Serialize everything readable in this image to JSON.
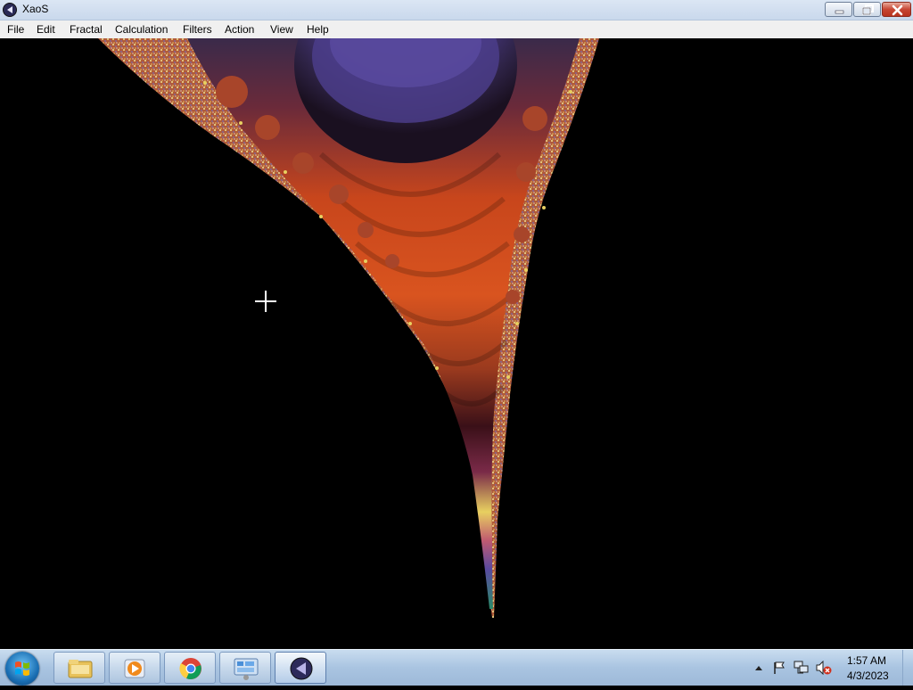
{
  "window": {
    "title": "XaoS",
    "icon": "xaos-icon",
    "controls": [
      "minimize-icon",
      "restore-icon",
      "close-icon"
    ]
  },
  "menu": {
    "items": [
      {
        "label": "File"
      },
      {
        "label": "Edit"
      },
      {
        "label": "Fractal"
      },
      {
        "label": "Calculation"
      },
      {
        "label": "Filters"
      },
      {
        "label": "Action"
      },
      {
        "label": "View"
      },
      {
        "label": "Help"
      }
    ]
  },
  "canvas": {
    "content": "mandelbrot-fractal-render",
    "colors": {
      "background": "#000000",
      "bulb_purple": "#4b3d8a",
      "band_dark": "#2a1a3a",
      "band_orange": "#d24a1a",
      "band_maroon": "#8a2f4a",
      "band_yellow": "#e8d060"
    }
  },
  "taskbar": {
    "start_icon": "windows-start-icon",
    "pinned": [
      {
        "icon": "file-explorer-icon"
      },
      {
        "icon": "media-player-icon"
      },
      {
        "icon": "chrome-icon"
      },
      {
        "icon": "control-panel-icon"
      },
      {
        "icon": "xaos-icon",
        "active": true
      }
    ],
    "tray": {
      "icons": [
        "show-hidden-icons-chevron-icon",
        "action-center-flag-icon",
        "network-icon",
        "volume-muted-icon"
      ],
      "time": "1:57 AM",
      "date": "4/3/2023"
    }
  }
}
